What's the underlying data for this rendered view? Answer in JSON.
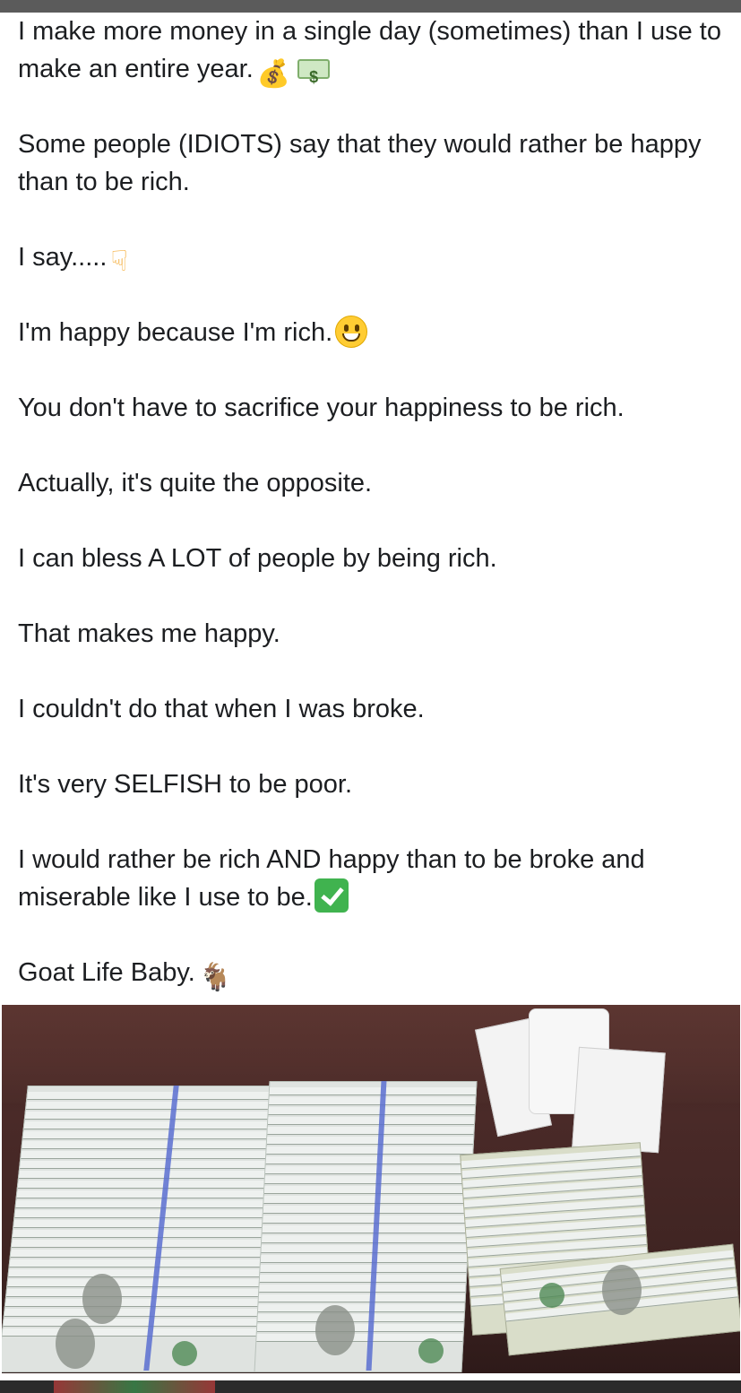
{
  "post": {
    "paragraphs": [
      {
        "text": "I make more money in a single day (sometimes) than I use to make an entire year.",
        "emoji": [
          "money-bag-icon",
          "dollar-bills-icon"
        ]
      },
      {
        "text": "Some people (IDIOTS) say that they would rather be happy than to be rich."
      },
      {
        "text": "I say.....",
        "emoji": [
          "backhand-index-down-icon"
        ]
      },
      {
        "text": "I'm happy because I'm rich.",
        "emoji": [
          "grinning-face-icon"
        ]
      },
      {
        "text": "You don't have to sacrifice your happiness to be rich."
      },
      {
        "text": "Actually, it's quite the opposite."
      },
      {
        "text": "I can bless A LOT of people by being rich."
      },
      {
        "text": "That makes me happy."
      },
      {
        "text": "I couldn't do that when I was broke."
      },
      {
        "text": "It's very SELFISH to be poor."
      },
      {
        "text": "I would rather be rich AND happy than to be broke and miserable like I use to be.",
        "emoji": [
          "check-mark-button-icon"
        ]
      },
      {
        "text": "Goat Life Baby.",
        "emoji": [
          "goat-icon"
        ]
      }
    ]
  },
  "photo": {
    "subject": "stacks-of-cash-and-receipts-on-table"
  },
  "colors": {
    "text": "#1c1e21",
    "background": "#ffffff",
    "table": "#3f2422"
  }
}
